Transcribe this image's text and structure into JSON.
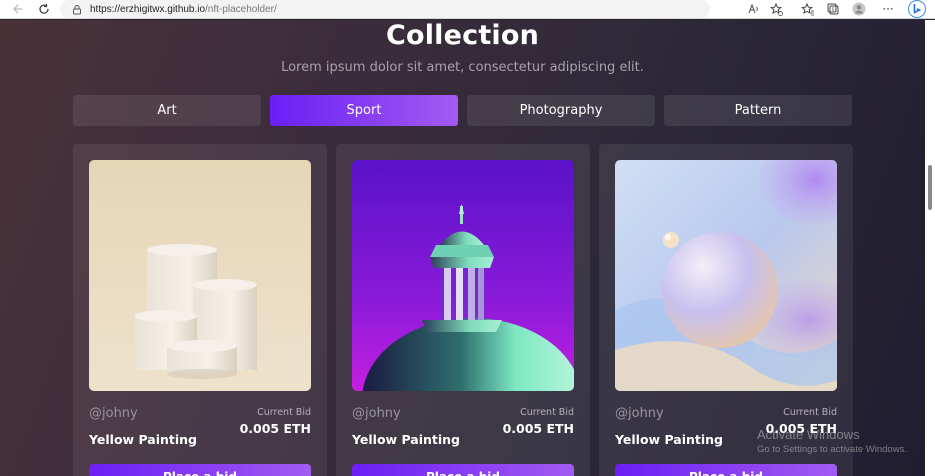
{
  "browser": {
    "url_domain": "https://erzhigitwx.github.io",
    "url_path": "/nft-placeholder/"
  },
  "page": {
    "title": "Collection",
    "subtitle": "Lorem ipsum dolor sit amet, consectetur adipiscing elit.",
    "tabs": [
      {
        "label": "Art",
        "active": false
      },
      {
        "label": "Sport",
        "active": true
      },
      {
        "label": "Photography",
        "active": false
      },
      {
        "label": "Pattern",
        "active": false
      }
    ],
    "cards": [
      {
        "author": "@johny",
        "bid_label": "Current Bid",
        "bid_value": "0.005 ETH",
        "name": "Yellow Painting",
        "button": "Place a bid"
      },
      {
        "author": "@johny",
        "bid_label": "Current Bid",
        "bid_value": "0.005 ETH",
        "name": "Yellow Painting",
        "button": "Place a bid"
      },
      {
        "author": "@johny",
        "bid_label": "Current Bid",
        "bid_value": "0.005 ETH",
        "name": "Yellow Painting",
        "button": "Place a bid"
      }
    ]
  },
  "watermark": {
    "line1": "Activate Windows",
    "line2": "Go to Settings to activate Windows."
  },
  "colors": {
    "accent_start": "#6b1ff5",
    "accent_end": "#a25bf2"
  }
}
